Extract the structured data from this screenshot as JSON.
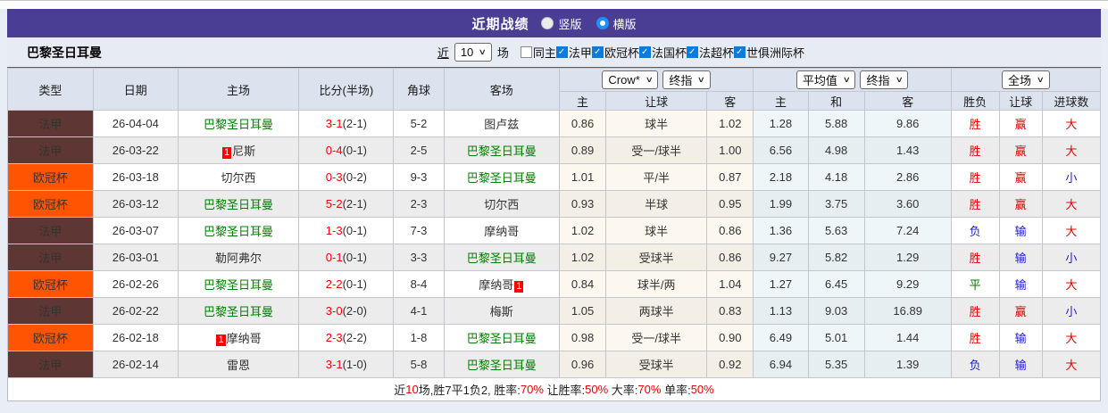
{
  "title_bar": {
    "title": "近期战绩",
    "radios": [
      {
        "label": "竖版",
        "selected": false
      },
      {
        "label": "横版",
        "selected": true
      }
    ]
  },
  "filter_bar": {
    "team": "巴黎圣日耳曼",
    "recent_label": "近",
    "recent_value": "10",
    "recent_suffix": "场",
    "checkboxes": [
      {
        "label": "同主",
        "checked": false
      },
      {
        "label": "法甲",
        "checked": true
      },
      {
        "label": "欧冠杯",
        "checked": true
      },
      {
        "label": "法国杯",
        "checked": true
      },
      {
        "label": "法超杯",
        "checked": true
      },
      {
        "label": "世俱洲际杯",
        "checked": true
      }
    ]
  },
  "table": {
    "selects": {
      "bookmaker": "Crow*",
      "bookmaker_stage": "终指",
      "avg": "平均值",
      "avg_stage": "终指",
      "scope": "全场"
    },
    "main_headers": [
      "类型",
      "日期",
      "主场",
      "比分(半场)",
      "角球",
      "客场"
    ],
    "sub_headers": [
      "主",
      "让球",
      "客",
      "主",
      "和",
      "客",
      "胜负",
      "让球",
      "进球数"
    ],
    "league_colors": {
      "法甲": "#5e3735",
      "欧冠杯": "#ff5402"
    },
    "rows": [
      {
        "league": "法甲",
        "league_bg": "#5e3735",
        "date": "26-04-04",
        "home": {
          "name": "巴黎圣日耳曼",
          "highlight": true
        },
        "score": "3-1",
        "half": "(2-1)",
        "corners": "5-2",
        "away": {
          "name": "图卢兹",
          "highlight": false
        },
        "handicap": {
          "home": "0.86",
          "line": "球半",
          "away": "1.02"
        },
        "europe": {
          "home": "1.28",
          "draw": "5.88",
          "away": "9.86"
        },
        "outcome": [
          {
            "text": "胜",
            "color": "red"
          },
          {
            "text": "赢",
            "color": "red"
          },
          {
            "text": "大",
            "color": "red"
          }
        ]
      },
      {
        "league": "法甲",
        "league_bg": "#5e3735",
        "date": "26-03-22",
        "home": {
          "name": "尼斯",
          "highlight": false,
          "card": "1",
          "card_side": "left"
        },
        "score": "0-4",
        "half": "(0-1)",
        "corners": "2-5",
        "away": {
          "name": "巴黎圣日耳曼",
          "highlight": true
        },
        "handicap": {
          "home": "0.89",
          "line": "受一/球半",
          "away": "1.00"
        },
        "europe": {
          "home": "6.56",
          "draw": "4.98",
          "away": "1.43"
        },
        "outcome": [
          {
            "text": "胜",
            "color": "red"
          },
          {
            "text": "赢",
            "color": "red"
          },
          {
            "text": "大",
            "color": "red"
          }
        ]
      },
      {
        "league": "欧冠杯",
        "league_bg": "#ff5402",
        "date": "26-03-18",
        "home": {
          "name": "切尔西",
          "highlight": false
        },
        "score": "0-3",
        "half": "(0-2)",
        "corners": "9-3",
        "away": {
          "name": "巴黎圣日耳曼",
          "highlight": true
        },
        "handicap": {
          "home": "1.01",
          "line": "平/半",
          "away": "0.87"
        },
        "europe": {
          "home": "2.18",
          "draw": "4.18",
          "away": "2.86"
        },
        "outcome": [
          {
            "text": "胜",
            "color": "red"
          },
          {
            "text": "赢",
            "color": "red"
          },
          {
            "text": "小",
            "color": "blue"
          }
        ]
      },
      {
        "league": "欧冠杯",
        "league_bg": "#ff5402",
        "date": "26-03-12",
        "home": {
          "name": "巴黎圣日耳曼",
          "highlight": true
        },
        "score": "5-2",
        "half": "(2-1)",
        "corners": "2-3",
        "away": {
          "name": "切尔西",
          "highlight": false
        },
        "handicap": {
          "home": "0.93",
          "line": "半球",
          "away": "0.95"
        },
        "europe": {
          "home": "1.99",
          "draw": "3.75",
          "away": "3.60"
        },
        "outcome": [
          {
            "text": "胜",
            "color": "red"
          },
          {
            "text": "赢",
            "color": "red"
          },
          {
            "text": "大",
            "color": "red"
          }
        ]
      },
      {
        "league": "法甲",
        "league_bg": "#5e3735",
        "date": "26-03-07",
        "home": {
          "name": "巴黎圣日耳曼",
          "highlight": true
        },
        "score": "1-3",
        "half": "(0-1)",
        "corners": "7-3",
        "away": {
          "name": "摩纳哥",
          "highlight": false
        },
        "handicap": {
          "home": "1.02",
          "line": "球半",
          "away": "0.86"
        },
        "europe": {
          "home": "1.36",
          "draw": "5.63",
          "away": "7.24"
        },
        "outcome": [
          {
            "text": "负",
            "color": "blue"
          },
          {
            "text": "输",
            "color": "blue"
          },
          {
            "text": "大",
            "color": "red"
          }
        ]
      },
      {
        "league": "法甲",
        "league_bg": "#5e3735",
        "date": "26-03-01",
        "home": {
          "name": "勒阿弗尔",
          "highlight": false
        },
        "score": "0-1",
        "half": "(0-1)",
        "corners": "3-3",
        "away": {
          "name": "巴黎圣日耳曼",
          "highlight": true
        },
        "handicap": {
          "home": "1.02",
          "line": "受球半",
          "away": "0.86"
        },
        "europe": {
          "home": "9.27",
          "draw": "5.82",
          "away": "1.29"
        },
        "outcome": [
          {
            "text": "胜",
            "color": "red"
          },
          {
            "text": "输",
            "color": "blue"
          },
          {
            "text": "小",
            "color": "blue"
          }
        ]
      },
      {
        "league": "欧冠杯",
        "league_bg": "#ff5402",
        "date": "26-02-26",
        "home": {
          "name": "巴黎圣日耳曼",
          "highlight": true
        },
        "score": "2-2",
        "half": "(0-1)",
        "corners": "8-4",
        "away": {
          "name": "摩纳哥",
          "highlight": false,
          "card": "1",
          "card_side": "right"
        },
        "handicap": {
          "home": "0.84",
          "line": "球半/两",
          "away": "1.04"
        },
        "europe": {
          "home": "1.27",
          "draw": "6.45",
          "away": "9.29"
        },
        "outcome": [
          {
            "text": "平",
            "color": "green"
          },
          {
            "text": "输",
            "color": "blue"
          },
          {
            "text": "大",
            "color": "red"
          }
        ]
      },
      {
        "league": "法甲",
        "league_bg": "#5e3735",
        "date": "26-02-22",
        "home": {
          "name": "巴黎圣日耳曼",
          "highlight": true
        },
        "score": "3-0",
        "half": "(2-0)",
        "corners": "4-1",
        "away": {
          "name": "梅斯",
          "highlight": false
        },
        "handicap": {
          "home": "1.05",
          "line": "两球半",
          "away": "0.83"
        },
        "europe": {
          "home": "1.13",
          "draw": "9.03",
          "away": "16.89"
        },
        "outcome": [
          {
            "text": "胜",
            "color": "red"
          },
          {
            "text": "赢",
            "color": "red"
          },
          {
            "text": "小",
            "color": "blue"
          }
        ]
      },
      {
        "league": "欧冠杯",
        "league_bg": "#ff5402",
        "date": "26-02-18",
        "home": {
          "name": "摩纳哥",
          "highlight": false,
          "card": "1",
          "card_side": "left"
        },
        "score": "2-3",
        "half": "(2-2)",
        "corners": "1-8",
        "away": {
          "name": "巴黎圣日耳曼",
          "highlight": true
        },
        "handicap": {
          "home": "0.98",
          "line": "受一/球半",
          "away": "0.90"
        },
        "europe": {
          "home": "6.49",
          "draw": "5.01",
          "away": "1.44"
        },
        "outcome": [
          {
            "text": "胜",
            "color": "red"
          },
          {
            "text": "输",
            "color": "blue"
          },
          {
            "text": "大",
            "color": "red"
          }
        ]
      },
      {
        "league": "法甲",
        "league_bg": "#5e3735",
        "date": "26-02-14",
        "home": {
          "name": "雷恩",
          "highlight": false
        },
        "score": "3-1",
        "half": "(1-0)",
        "corners": "5-8",
        "away": {
          "name": "巴黎圣日耳曼",
          "highlight": true
        },
        "handicap": {
          "home": "0.96",
          "line": "受球半",
          "away": "0.92"
        },
        "europe": {
          "home": "6.94",
          "draw": "5.35",
          "away": "1.39"
        },
        "outcome": [
          {
            "text": "负",
            "color": "blue"
          },
          {
            "text": "输",
            "color": "blue"
          },
          {
            "text": "大",
            "color": "red"
          }
        ]
      }
    ]
  },
  "summary": {
    "parts": [
      {
        "text": "近",
        "color": "black"
      },
      {
        "text": "10",
        "color": "red"
      },
      {
        "text": "场,胜7平1负2, 胜率:",
        "color": "black"
      },
      {
        "text": "70%",
        "color": "red"
      },
      {
        "text": " 让胜率:",
        "color": "black"
      },
      {
        "text": "50%",
        "color": "red"
      },
      {
        "text": " 大率:",
        "color": "black"
      },
      {
        "text": "70%",
        "color": "red"
      },
      {
        "text": " 单率:",
        "color": "black"
      },
      {
        "text": "50%",
        "color": "red"
      }
    ]
  },
  "colors": {
    "header_purple": "#4a3e94",
    "ligue1_badge": "#5e3735",
    "ucl_badge": "#ff5402",
    "psg_green": "#008000",
    "score_red": "#ff0000",
    "loss_blue": "#2020d0",
    "draw_green": "#007800",
    "checkbox_blue": "#0b7bdd",
    "handicap_cell_bg": "#fdf8ef",
    "avg_cell_bg": "#eef6fa"
  }
}
